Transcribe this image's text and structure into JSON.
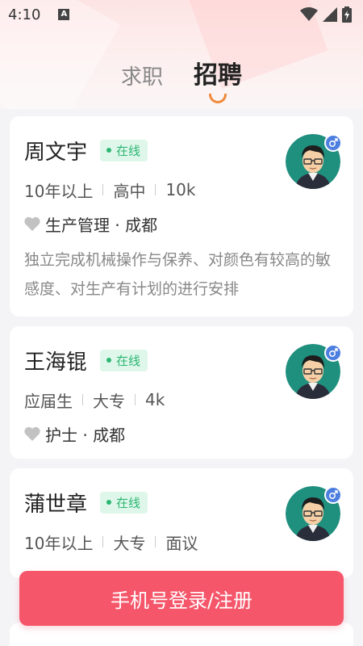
{
  "status_bar": {
    "time": "4:10",
    "icons": [
      "a-icon",
      "wifi-icon",
      "signal-icon",
      "battery-icon"
    ]
  },
  "tabs": [
    {
      "label": "求职",
      "active": false
    },
    {
      "label": "招聘",
      "active": true
    }
  ],
  "cards": [
    {
      "name": "周文宇",
      "status": "在线",
      "experience": "10年以上",
      "education": "高中",
      "salary": "10k",
      "job": "生产管理 · 成都",
      "description": "独立完成机械操作与保养、对颜色有较高的敏感度、对生产有计划的进行安排",
      "gender": "male"
    },
    {
      "name": "王海锟",
      "status": "在线",
      "experience": "应届生",
      "education": "大专",
      "salary": "4k",
      "job": "护士 · 成都",
      "gender": "male"
    },
    {
      "name": "蒲世章",
      "status": "在线",
      "experience": "10年以上",
      "education": "大专",
      "salary": "面议",
      "gender": "male"
    }
  ],
  "login_button": "手机号登录/注册",
  "colors": {
    "accent": "#f5566a",
    "online": "#2bb673",
    "tab_indicator": "#f08a3c",
    "gender": "#4d7fe0"
  }
}
